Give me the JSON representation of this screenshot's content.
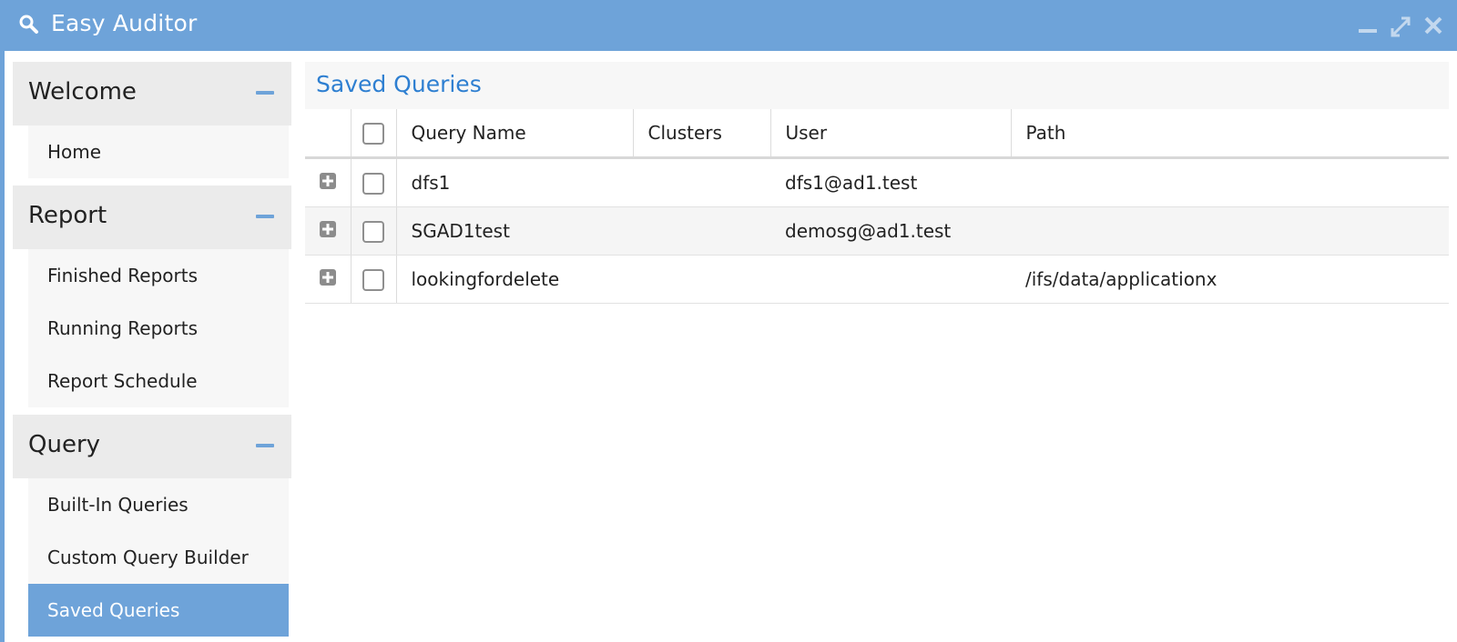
{
  "app": {
    "title": "Easy Auditor"
  },
  "colors": {
    "accent": "#6ea3d9",
    "heading": "#2e7fd1"
  },
  "sidebar": {
    "sections": [
      {
        "label": "Welcome",
        "items": [
          "Home"
        ]
      },
      {
        "label": "Report",
        "items": [
          "Finished Reports",
          "Running Reports",
          "Report Schedule"
        ]
      },
      {
        "label": "Query",
        "items": [
          "Built-In Queries",
          "Custom Query Builder",
          "Saved Queries"
        ]
      }
    ],
    "active_item": "Saved Queries"
  },
  "main": {
    "heading": "Saved Queries",
    "columns": [
      "Query Name",
      "Clusters",
      "User",
      "Path"
    ],
    "rows": [
      {
        "query_name": "dfs1",
        "clusters": "",
        "user": "dfs1@ad1.test",
        "path": ""
      },
      {
        "query_name": "SGAD1test",
        "clusters": "",
        "user": "demosg@ad1.test",
        "path": ""
      },
      {
        "query_name": "lookingfordelete",
        "clusters": "",
        "user": "",
        "path": "/ifs/data/applicationx"
      }
    ]
  }
}
